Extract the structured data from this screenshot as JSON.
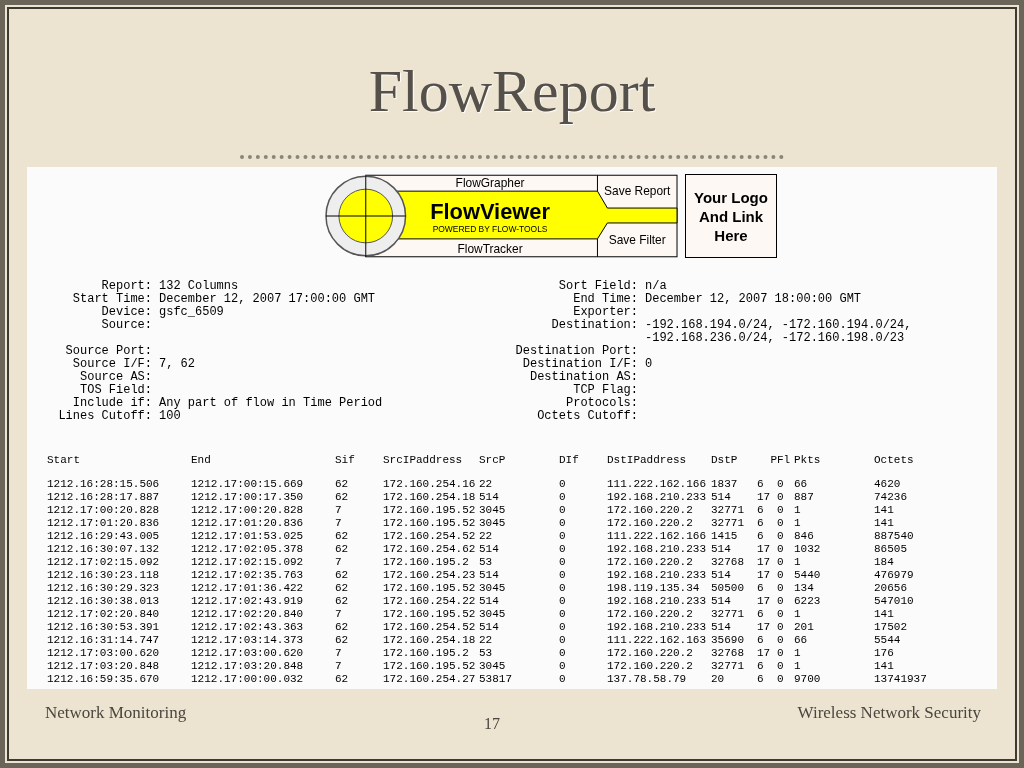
{
  "slide": {
    "title": "FlowReport"
  },
  "banner": {
    "top_link": "FlowGrapher",
    "product_name": "FlowViewer",
    "tagline": "POWERED BY FLOW-TOOLS",
    "bottom_link": "FlowTracker",
    "save_report": "Save Report",
    "save_filter": "Save Filter",
    "logo_lines": [
      "Your Logo",
      "And Link",
      "Here"
    ]
  },
  "report_left": [
    {
      "label": "Report:",
      "value": "132 Columns"
    },
    {
      "label": "Start Time:",
      "value": "December 12, 2007 17:00:00 GMT"
    },
    {
      "label": "Device:",
      "value": "gsfc_6509"
    },
    {
      "label": "Source:"
    },
    {
      "label": "Source Port:"
    },
    {
      "label": "Source I/F:",
      "value": "7, 62"
    },
    {
      "label": "Source AS:"
    },
    {
      "label": "TOS Field:"
    },
    {
      "label": "Include if:",
      "value": "Any part of flow in Time Period"
    },
    {
      "label": "Lines Cutoff:",
      "value": "100"
    }
  ],
  "report_right": [
    {
      "label": "Sort Field:",
      "value": "n/a"
    },
    {
      "label": "End Time:",
      "value": "December 12, 2007 18:00:00 GMT"
    },
    {
      "label": "Exporter:"
    },
    {
      "label": "Destination:",
      "value_lines": [
        "-192.168.194.0/24, -172.160.194.0/24,",
        "-192.168.236.0/24, -172.160.198.0/23"
      ]
    },
    {
      "label": "Destination Port:"
    },
    {
      "label": "Destination I/F:",
      "value": "0"
    },
    {
      "label": "Destination AS:"
    },
    {
      "label": "TCP Flag:"
    },
    {
      "label": "Protocols:"
    },
    {
      "label": "Octets Cutoff:"
    }
  ],
  "flow_table": {
    "columns": [
      "Start",
      "End",
      "Sif",
      "SrcIPaddress",
      "SrcP",
      "DIf",
      "DstIPaddress",
      "DstP",
      "P",
      "Fl",
      "Pkts",
      "Octets"
    ],
    "rows": [
      [
        "1212.16:28:15.506",
        "1212.17:00:15.669",
        "62",
        "172.160.254.16",
        "22",
        "0",
        "111.222.162.166",
        "1837",
        "6",
        "0",
        "66",
        "4620"
      ],
      [
        "1212.16:28:17.887",
        "1212.17:00:17.350",
        "62",
        "172.160.254.18",
        "514",
        "0",
        "192.168.210.233",
        "514",
        "17",
        "0",
        "887",
        "74236"
      ],
      [
        "1212.17:00:20.828",
        "1212.17:00:20.828",
        "7",
        "172.160.195.52",
        "3045",
        "0",
        "172.160.220.2",
        "32771",
        "6",
        "0",
        "1",
        "141"
      ],
      [
        "1212.17:01:20.836",
        "1212.17:01:20.836",
        "7",
        "172.160.195.52",
        "3045",
        "0",
        "172.160.220.2",
        "32771",
        "6",
        "0",
        "1",
        "141"
      ],
      [
        "1212.16:29:43.005",
        "1212.17:01:53.025",
        "62",
        "172.160.254.52",
        "22",
        "0",
        "111.222.162.166",
        "1415",
        "6",
        "0",
        "846",
        "887540"
      ],
      [
        "1212.16:30:07.132",
        "1212.17:02:05.378",
        "62",
        "172.160.254.62",
        "514",
        "0",
        "192.168.210.233",
        "514",
        "17",
        "0",
        "1032",
        "86505"
      ],
      [
        "1212.17:02:15.092",
        "1212.17:02:15.092",
        "7",
        "172.160.195.2",
        "53",
        "0",
        "172.160.220.2",
        "32768",
        "17",
        "0",
        "1",
        "184"
      ],
      [
        "1212.16:30:23.118",
        "1212.17:02:35.763",
        "62",
        "172.160.254.23",
        "514",
        "0",
        "192.168.210.233",
        "514",
        "17",
        "0",
        "5440",
        "476979"
      ],
      [
        "1212.16:30:29.323",
        "1212.17:01:36.422",
        "62",
        "172.160.195.52",
        "3045",
        "0",
        "198.119.135.34",
        "50500",
        "6",
        "0",
        "134",
        "20656"
      ],
      [
        "1212.16:30:38.013",
        "1212.17:02:43.919",
        "62",
        "172.160.254.22",
        "514",
        "0",
        "192.168.210.233",
        "514",
        "17",
        "0",
        "6223",
        "547010"
      ],
      [
        "1212.17:02:20.840",
        "1212.17:02:20.840",
        "7",
        "172.160.195.52",
        "3045",
        "0",
        "172.160.220.2",
        "32771",
        "6",
        "0",
        "1",
        "141"
      ],
      [
        "1212.16:30:53.391",
        "1212.17:02:43.363",
        "62",
        "172.160.254.52",
        "514",
        "0",
        "192.168.210.233",
        "514",
        "17",
        "0",
        "201",
        "17502"
      ],
      [
        "1212.16:31:14.747",
        "1212.17:03:14.373",
        "62",
        "172.160.254.18",
        "22",
        "0",
        "111.222.162.163",
        "35690",
        "6",
        "0",
        "66",
        "5544"
      ],
      [
        "1212.17:03:00.620",
        "1212.17:03:00.620",
        "7",
        "172.160.195.2",
        "53",
        "0",
        "172.160.220.2",
        "32768",
        "17",
        "0",
        "1",
        "176"
      ],
      [
        "1212.17:03:20.848",
        "1212.17:03:20.848",
        "7",
        "172.160.195.52",
        "3045",
        "0",
        "172.160.220.2",
        "32771",
        "6",
        "0",
        "1",
        "141"
      ],
      [
        "1212.16:59:35.670",
        "1212.17:00:00.032",
        "62",
        "172.160.254.27",
        "53817",
        "0",
        "137.78.58.79",
        "20",
        "6",
        "0",
        "9700",
        "13741937"
      ]
    ]
  },
  "footer": {
    "left": "Network Monitoring",
    "page_number": "17",
    "right": "Wireless Network Security"
  }
}
